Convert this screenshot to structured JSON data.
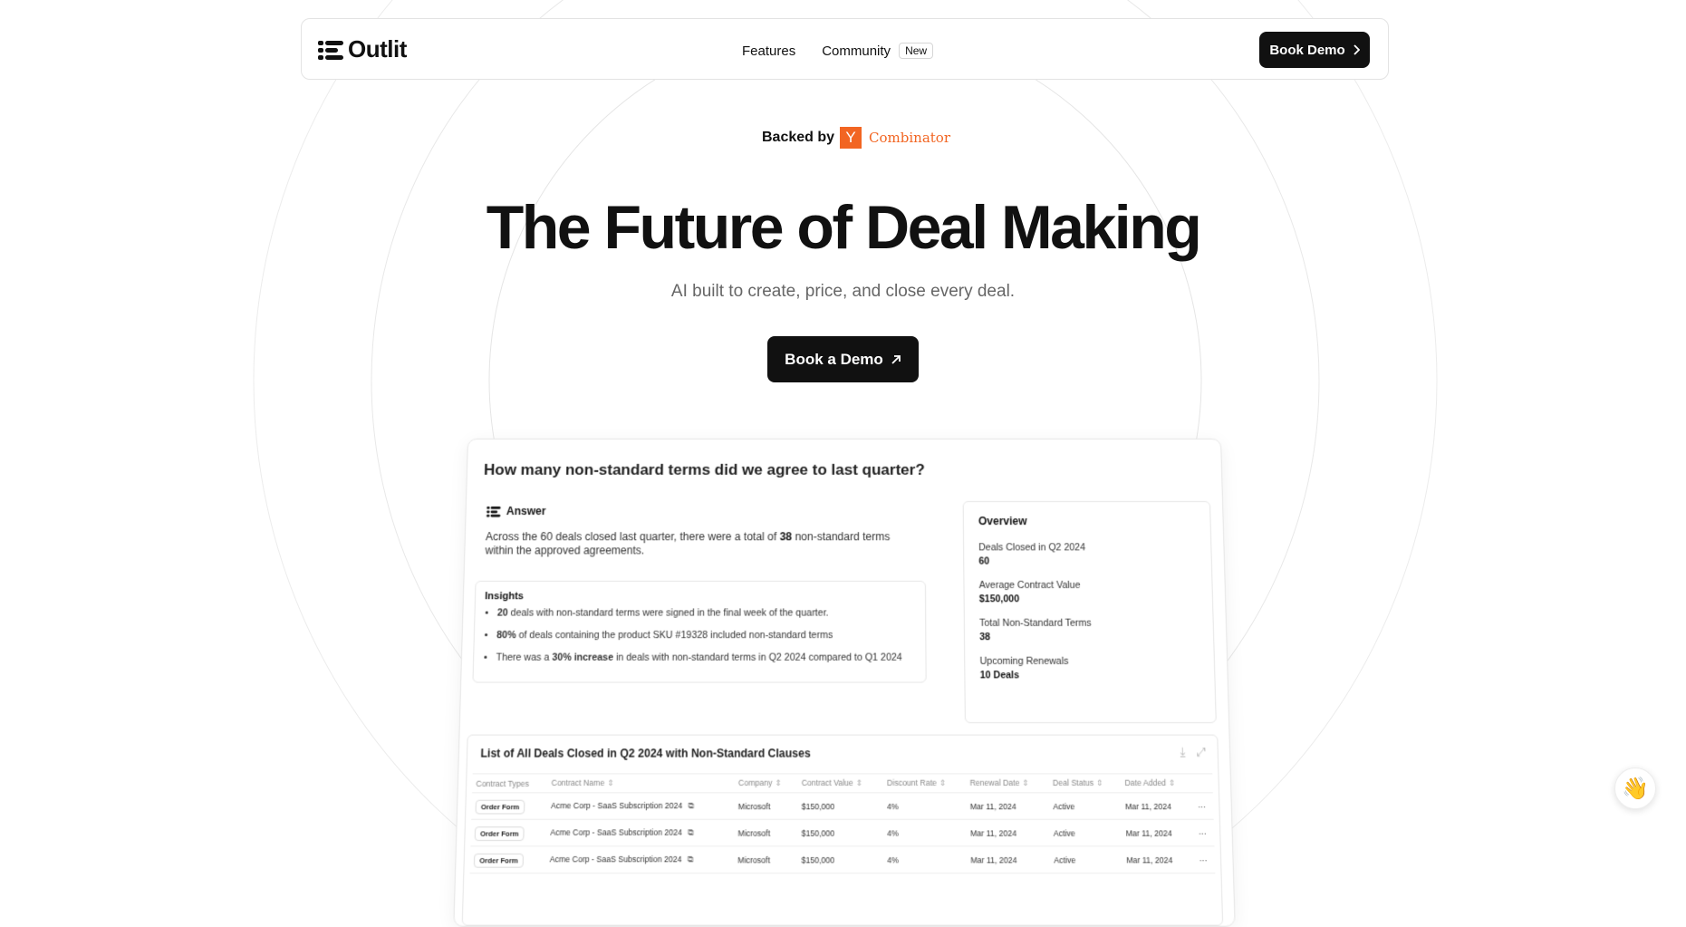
{
  "nav": {
    "logo_text": "Outlit",
    "links": [
      {
        "label": "Features"
      },
      {
        "label": "Community",
        "badge": "New"
      }
    ],
    "cta": "Book Demo"
  },
  "hero": {
    "backed_label": "Backed by",
    "yc_letter": "Y",
    "yc_name": "Combinator",
    "title": "The Future of Deal Making",
    "subtitle": "AI built to create, price, and close every deal.",
    "cta": "Book a Demo"
  },
  "mock": {
    "question": "How many non-standard terms did we agree to last quarter?",
    "answer_label": "Answer",
    "answer_text_1": "Across the 60 deals closed last quarter, there were a total of",
    "answer_bold": "38",
    "answer_text_2": "non-standard terms within the approved agreements.",
    "insights_title": "Insights",
    "insights": [
      {
        "bold": "20",
        "text": " deals with non-standard terms were signed in the final week of the quarter."
      },
      {
        "bold": "80%",
        "text": " of deals containing the product SKU #19328 included non-standard terms"
      },
      {
        "pre": "There was a ",
        "bold": "30% increase",
        "text": " in deals with non-standard terms in Q2 2024 compared to Q1 2024"
      }
    ],
    "overview_title": "Overview",
    "overview": [
      {
        "label": "Deals Closed in Q2 2024",
        "value": "60"
      },
      {
        "label": "Average Contract Value",
        "value": "$150,000"
      },
      {
        "label": "Total Non-Standard Terms",
        "value": "38"
      },
      {
        "label": "Upcoming Renewals",
        "value": "10 Deals"
      }
    ],
    "table_title": "List of All Deals Closed in Q2 2024 with Non-Standard Clauses",
    "columns": [
      "Contract Types",
      "Contract Name",
      "Company",
      "Contract Value",
      "Discount Rate",
      "Renewal Date",
      "Deal Status",
      "Date Added"
    ],
    "rows": [
      {
        "type": "Order Form",
        "name": "Acme Corp - SaaS Subscription 2024",
        "company": "Microsoft",
        "value": "$150,000",
        "discount": "4%",
        "renewal": "Mar 11, 2024",
        "status": "Active",
        "added": "Mar 11, 2024"
      },
      {
        "type": "Order Form",
        "name": "Acme Corp - SaaS Subscription 2024",
        "company": "Microsoft",
        "value": "$150,000",
        "discount": "4%",
        "renewal": "Mar 11, 2024",
        "status": "Active",
        "added": "Mar 11, 2024"
      },
      {
        "type": "Order Form",
        "name": "Acme Corp - SaaS Subscription 2024",
        "company": "Microsoft",
        "value": "$150,000",
        "discount": "4%",
        "renewal": "Mar 11, 2024",
        "status": "Active",
        "added": "Mar 11, 2024"
      }
    ],
    "row_menu": "···"
  },
  "chat_widget_emoji": "👋",
  "colors": {
    "brand_dark": "#111111",
    "yc_orange": "#f26522",
    "ring": "#e8e8e8"
  }
}
